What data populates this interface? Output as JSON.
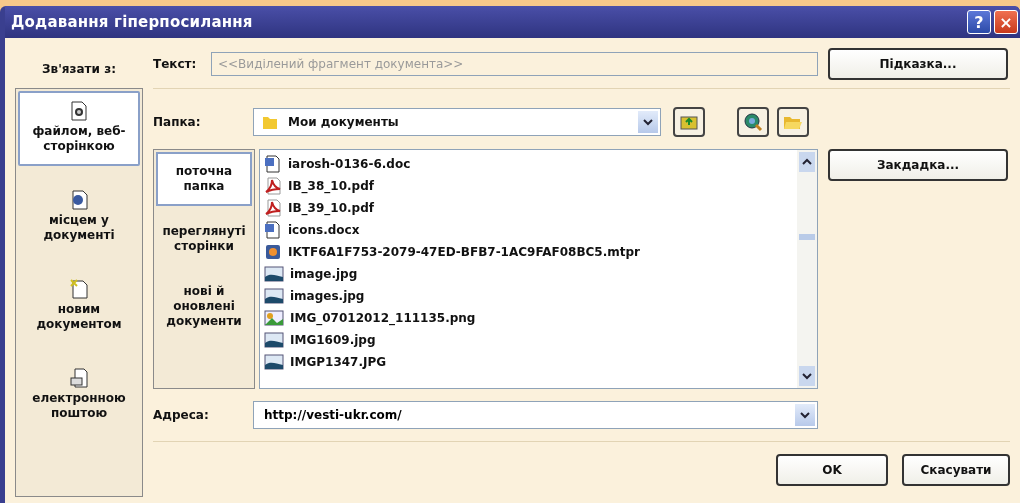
{
  "window": {
    "title": "Додавання гіперпосилання",
    "help": "?",
    "close": "×"
  },
  "link_to": {
    "label": "Зв'язати з:",
    "items": [
      {
        "kind": "file",
        "label": "файлом, веб-сторінкою",
        "selected": true
      },
      {
        "kind": "place",
        "label": "місцем у документі",
        "selected": false
      },
      {
        "kind": "new",
        "label": "новим документом",
        "selected": false
      },
      {
        "kind": "email",
        "label": "електронною поштою",
        "selected": false
      }
    ]
  },
  "text_field": {
    "label": "Текст:",
    "placeholder": "<<Виділений фрагмент документа>>"
  },
  "tip_button": "Підказка...",
  "folder": {
    "label": "Папка:",
    "value": "Мои документы"
  },
  "bookmark_button": "Закдадка...",
  "look_in": [
    {
      "label": "поточна папка",
      "selected": true
    },
    {
      "label": "переглянуті сторінки",
      "selected": false
    },
    {
      "label": "нові й оновлені документи",
      "selected": false
    }
  ],
  "files": [
    {
      "kind": "word",
      "name": "iarosh-0136-6.doc"
    },
    {
      "kind": "pdf",
      "name": "IB_38_10.pdf"
    },
    {
      "kind": "pdf",
      "name": "IB_39_10.pdf"
    },
    {
      "kind": "word",
      "name": "icons.docx"
    },
    {
      "kind": "app",
      "name": "IKTF6A1F753-2079-47ED-BFB7-1AC9FAF08BC5.mtpr"
    },
    {
      "kind": "image",
      "name": "image.jpg"
    },
    {
      "kind": "image",
      "name": "images.jpg"
    },
    {
      "kind": "png",
      "name": "IMG_07012012_111135.png"
    },
    {
      "kind": "image",
      "name": "IMG1609.jpg"
    },
    {
      "kind": "image",
      "name": "IMGP1347.JPG"
    }
  ],
  "address": {
    "label": "Адреса:",
    "value": "http://vesti-ukr.com/"
  },
  "buttons": [
    "OK",
    "Скасувати"
  ]
}
